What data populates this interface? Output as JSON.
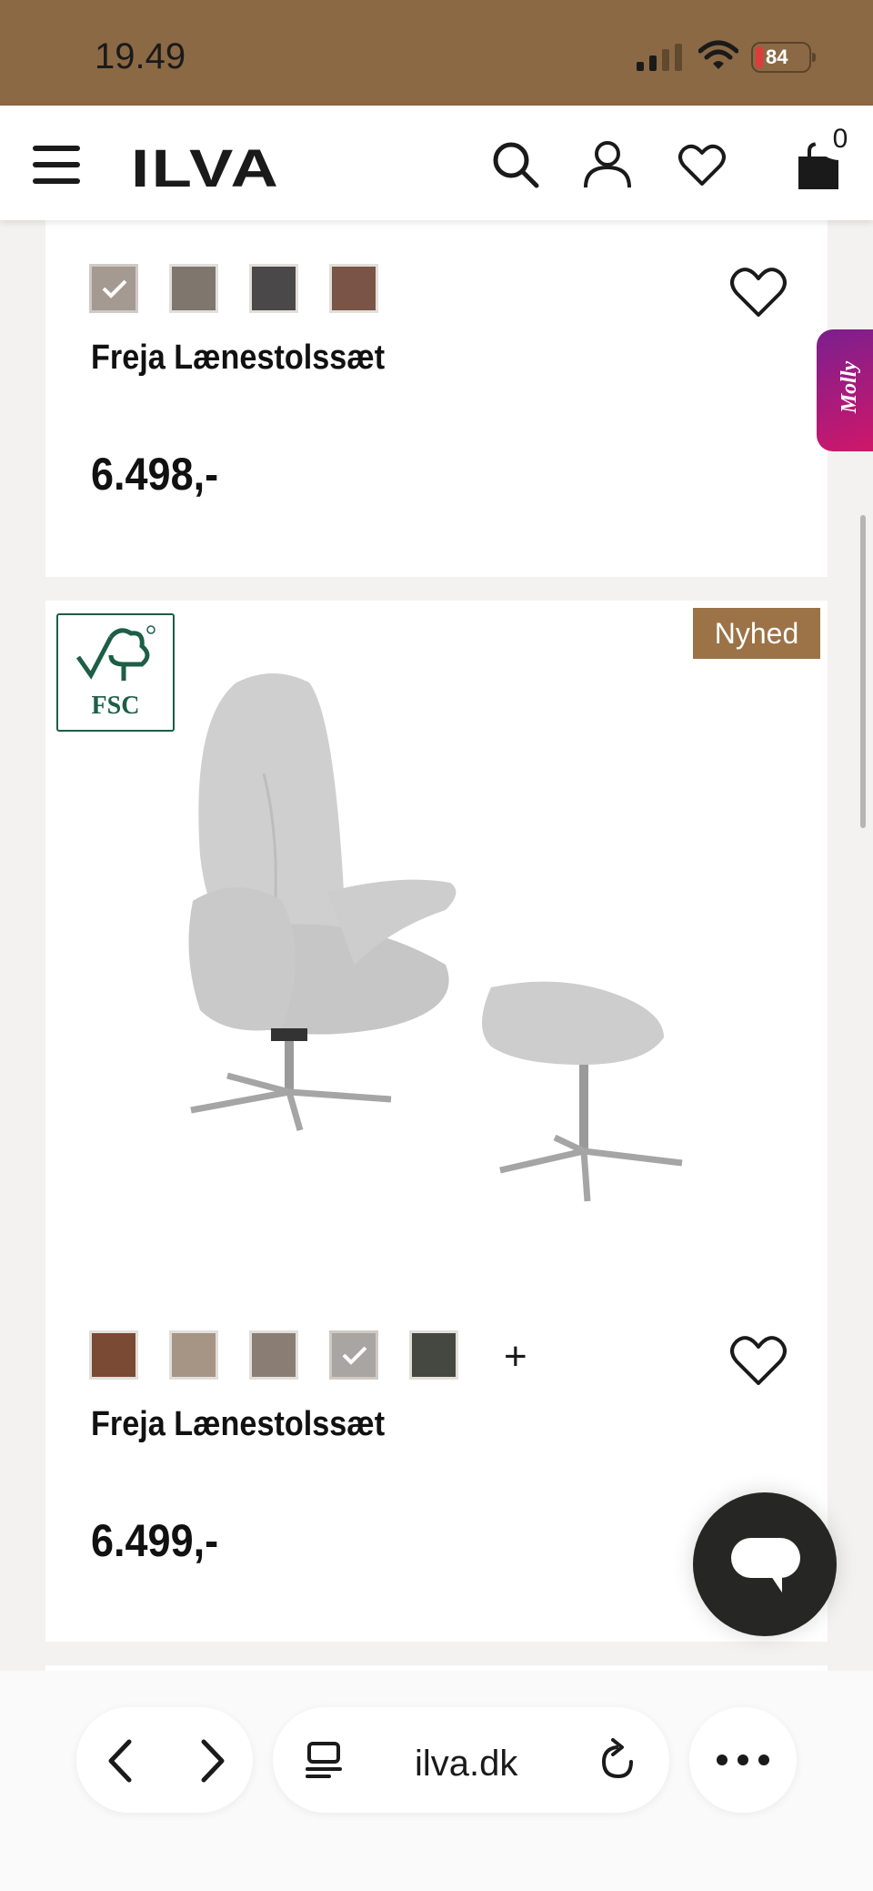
{
  "status": {
    "time": "19.49",
    "battery": "84"
  },
  "header": {
    "logo": "ILVA",
    "cart_count": "0"
  },
  "products": [
    {
      "title": "Freja Lænestolssæt",
      "price": "6.498,-",
      "swatches": [
        "#a49a91",
        "#7f766e",
        "#4a4849",
        "#7a5446"
      ],
      "selected_swatch": 0
    },
    {
      "title": "Freja Lænestolssæt",
      "price": "6.499,-",
      "badge": "Nyhed",
      "certification": "FSC",
      "swatches": [
        "#7a4a34",
        "#a69485",
        "#8a7e74",
        "#a8a5a2",
        "#454840"
      ],
      "selected_swatch": 3,
      "more_colors": "+"
    }
  ],
  "side_tab": {
    "label": "Molly"
  },
  "browser": {
    "url": "ilva.dk"
  }
}
